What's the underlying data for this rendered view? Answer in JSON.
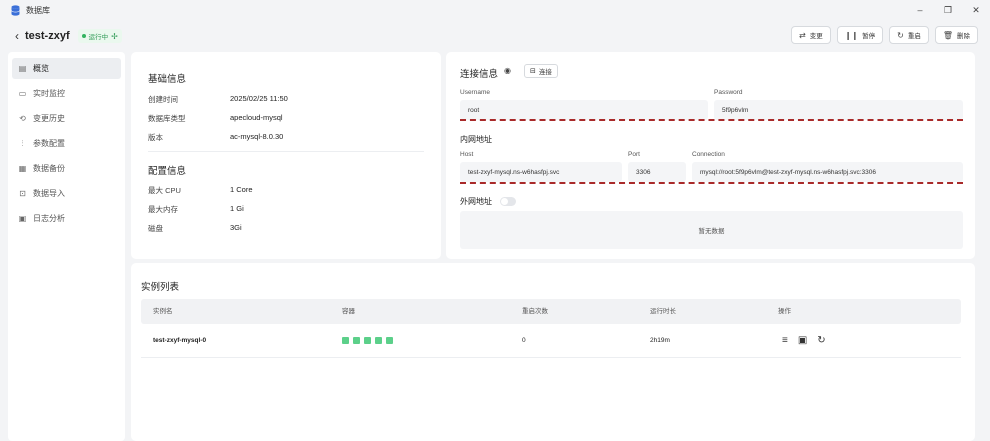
{
  "window": {
    "title": "数据库",
    "controls": [
      "minimize-icon",
      "restore-icon",
      "close-icon"
    ]
  },
  "header": {
    "name": "test-zxyf",
    "status": "运行中",
    "status_color": "#2e9a55",
    "actions": [
      {
        "label": "变更",
        "icon": "swap-icon"
      },
      {
        "label": "暂停",
        "icon": "pause-icon"
      },
      {
        "label": "重启",
        "icon": "restart-icon"
      },
      {
        "label": "删除",
        "icon": "trash-icon"
      }
    ]
  },
  "sidebar": {
    "items": [
      {
        "label": "概览",
        "icon": "overview-icon",
        "active": true
      },
      {
        "label": "实时监控",
        "icon": "monitor-icon"
      },
      {
        "label": "变更历史",
        "icon": "history-icon"
      },
      {
        "label": "参数配置",
        "icon": "sliders-icon"
      },
      {
        "label": "数据备份",
        "icon": "backup-icon"
      },
      {
        "label": "数据导入",
        "icon": "import-icon"
      },
      {
        "label": "日志分析",
        "icon": "log-icon"
      }
    ]
  },
  "basic": {
    "title": "基础信息",
    "rows": [
      {
        "label": "创建时间",
        "value": "2025/02/25 11:50"
      },
      {
        "label": "数据库类型",
        "value": "apecloud-mysql"
      },
      {
        "label": "版本",
        "value": "ac-mysql-8.0.30"
      }
    ],
    "config_title": "配置信息",
    "config_rows": [
      {
        "label": "最大 CPU",
        "value": "1 Core"
      },
      {
        "label": "最大内存",
        "value": "1 Gi"
      },
      {
        "label": "磁盘",
        "value": "3Gi"
      }
    ]
  },
  "connection": {
    "title": "连接信息",
    "connect_label": "连接",
    "username_label": "Username",
    "username": "root",
    "password_label": "Password",
    "password": "5f9p6vlm",
    "internal_title": "内网地址",
    "host_label": "Host",
    "host": "test-zxyf-mysql.ns-w6hasfpj.svc",
    "port_label": "Port",
    "port": "3306",
    "connection_label": "Connection",
    "connection": "mysql://root:5f9p6vlm@test-zxyf-mysql.ns-w6hasfpj.svc:3306",
    "external_title": "外网地址",
    "external_enabled": false,
    "empty_text": "暂无数据",
    "highlight_color": "#a92a2a"
  },
  "instances": {
    "title": "实例列表",
    "columns": [
      "实例名",
      "容器",
      "重启次数",
      "运行时长",
      "操作"
    ],
    "rows": [
      {
        "name": "test-zxyf-mysql-0",
        "containers": 5,
        "restarts": "0",
        "uptime": "2h19m"
      }
    ],
    "container_color": "#5cd08a",
    "row_actions": [
      "details-icon",
      "terminal-icon",
      "restart-icon"
    ]
  }
}
